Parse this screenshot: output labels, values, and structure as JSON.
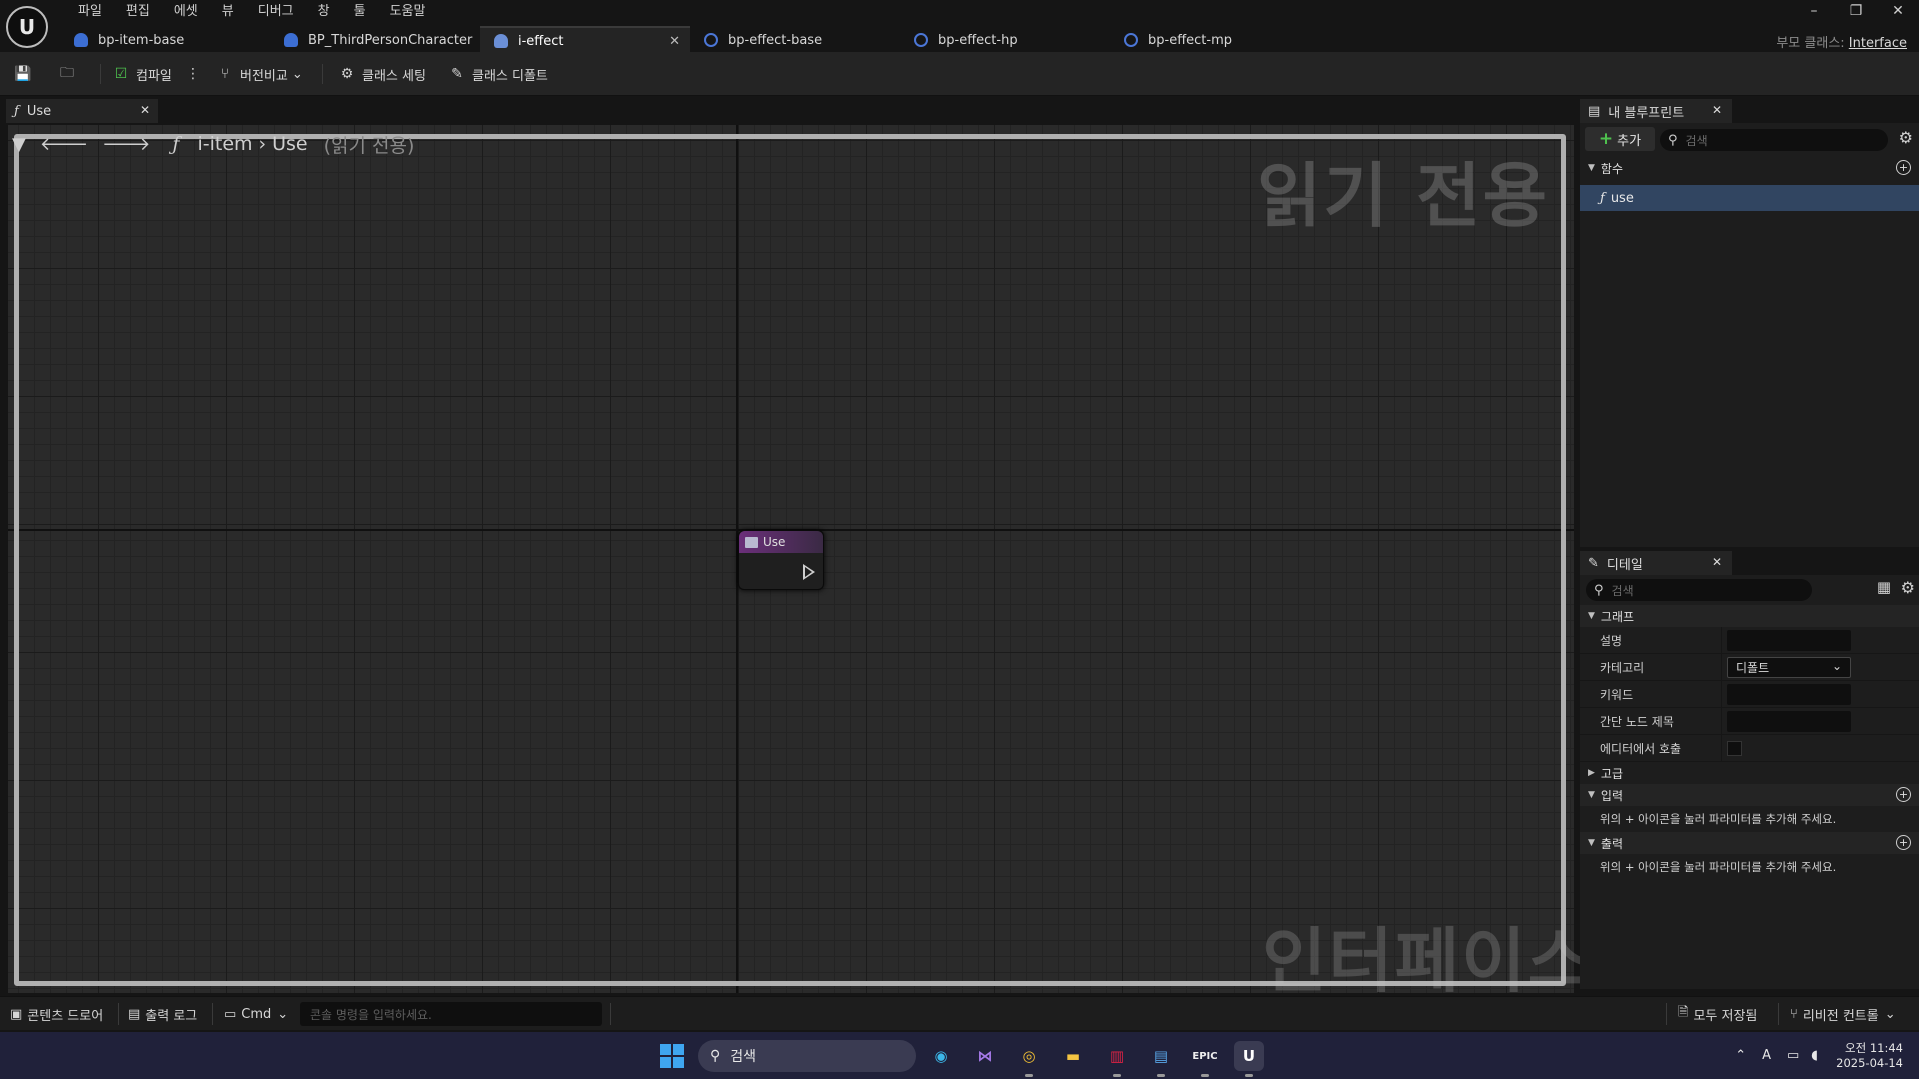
{
  "menu": [
    "파일",
    "편집",
    "에셋",
    "뷰",
    "디버그",
    "창",
    "툴",
    "도움말"
  ],
  "tabs": [
    {
      "label": "bp-item-base",
      "icon": "character-icon"
    },
    {
      "label": "BP_ThirdPersonCharacter",
      "icon": "character-icon"
    },
    {
      "label": "i-effect",
      "icon": "interface-icon",
      "active": true
    },
    {
      "label": "bp-effect-base",
      "icon": "blueprint-icon"
    },
    {
      "label": "bp-effect-hp",
      "icon": "blueprint-icon"
    },
    {
      "label": "bp-effect-mp",
      "icon": "blueprint-icon"
    }
  ],
  "parent_class": {
    "label": "부모 클래스:",
    "value": "Interface"
  },
  "toolbar": {
    "compile": "컴파일",
    "diff": "버전비교",
    "class_settings": "클래스 세팅",
    "class_defaults": "클래스 디폴트"
  },
  "graph": {
    "tab_label": "Use",
    "breadcrumb_func_icon": "ƒ",
    "breadcrumb_owner": "i-item",
    "breadcrumb_name": "Use",
    "breadcrumb_readonly": "(읽기 전용)",
    "watermark_top": "읽기 전용",
    "watermark_bottom": "인터페이스",
    "node_title": "Use"
  },
  "my_blueprint": {
    "title": "내 블루프린트",
    "add_label": "추가",
    "search_placeholder": "검색",
    "section_functions": "함수",
    "functions": [
      "use"
    ]
  },
  "details": {
    "title": "디테일",
    "search_placeholder": "검색",
    "section_graph": "그래프",
    "rows": {
      "description": "설명",
      "category": "카테고리",
      "category_value": "디폴트",
      "keywords": "키워드",
      "compact_title": "간단 노드 제목",
      "call_in_editor": "에디터에서 호출"
    },
    "section_advanced": "고급",
    "section_inputs": "입력",
    "inputs_hint": "위의 + 아이콘을 눌러 파라미터를 추가해 주세요.",
    "section_outputs": "출력",
    "outputs_hint": "위의 + 아이콘을 눌러 파라미터를 추가해 주세요."
  },
  "statusbar": {
    "content_drawer": "콘텐츠 드로어",
    "output_log": "출력 로그",
    "cmd": "Cmd",
    "console_placeholder": "콘솔 명령을 입력하세요.",
    "save_all": "모두 저장됨",
    "revision_control": "리비전 컨트롤"
  },
  "taskbar": {
    "search_label": "검색",
    "time": "오전 11:44",
    "date": "2025-04-14",
    "ime": "A"
  }
}
